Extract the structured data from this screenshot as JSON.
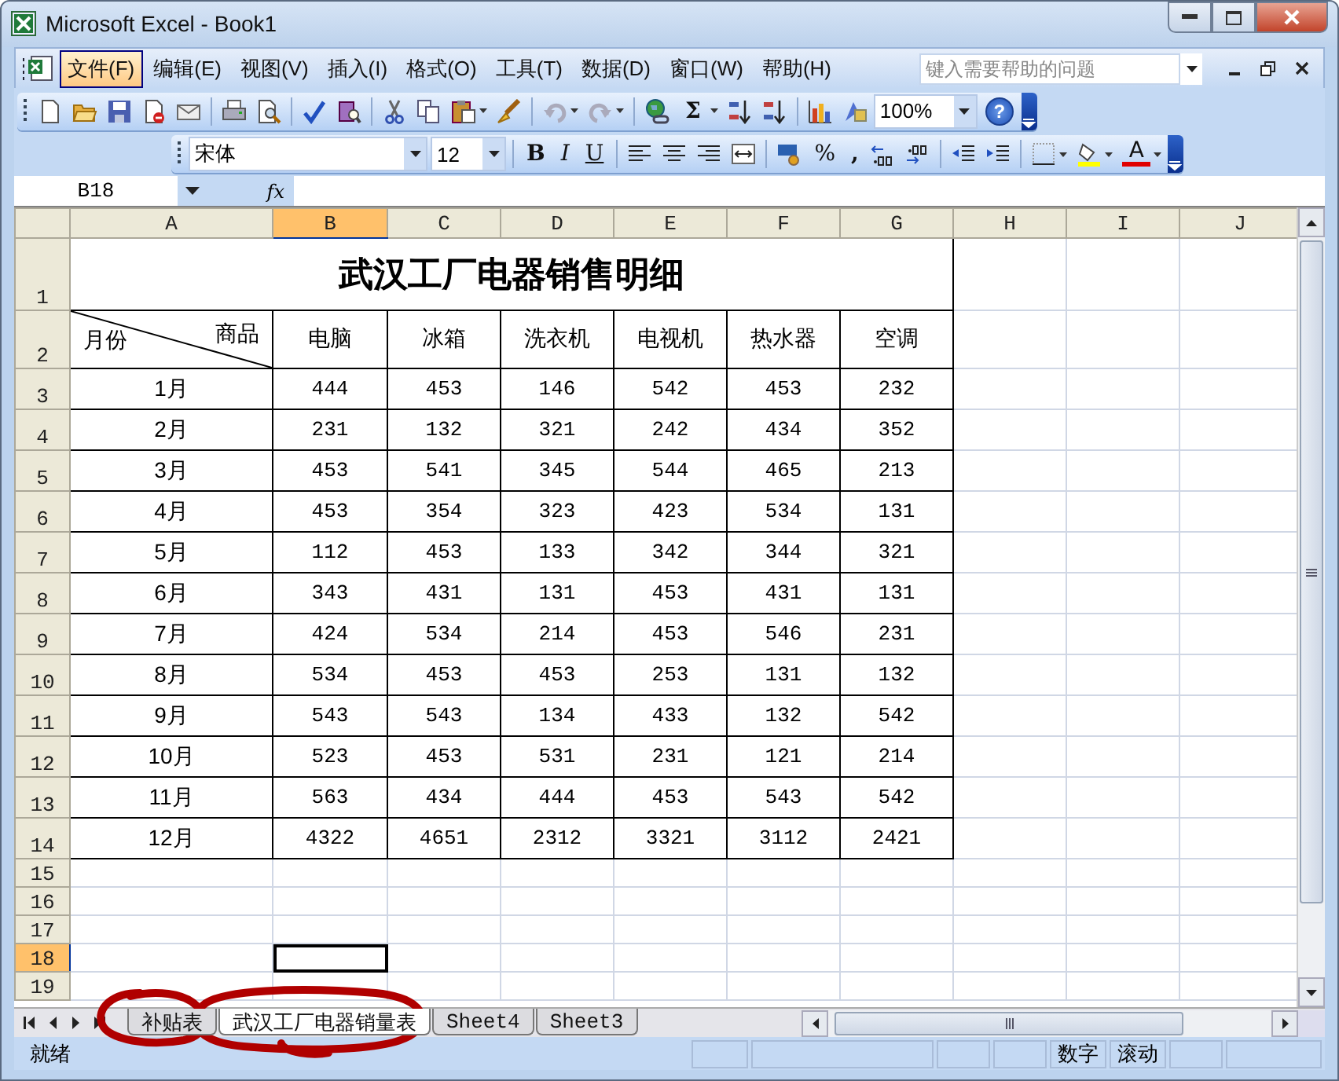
{
  "window": {
    "title": "Microsoft Excel - Book1"
  },
  "menu": [
    {
      "label": "文件(F)",
      "selected": true
    },
    {
      "label": "编辑(E)",
      "selected": false
    },
    {
      "label": "视图(V)",
      "selected": false
    },
    {
      "label": "插入(I)",
      "selected": false
    },
    {
      "label": "格式(O)",
      "selected": false
    },
    {
      "label": "工具(T)",
      "selected": false
    },
    {
      "label": "数据(D)",
      "selected": false
    },
    {
      "label": "窗口(W)",
      "selected": false
    },
    {
      "label": "帮助(H)",
      "selected": false
    }
  ],
  "help_box": {
    "placeholder": "键入需要帮助的问题"
  },
  "standard_toolbar": {
    "autosum": "Σ",
    "zoom": "100%",
    "help": "?"
  },
  "formatting_toolbar": {
    "font": "宋体",
    "size": "12",
    "bold": "B",
    "italic": "I",
    "underline": "U",
    "percent": "%",
    "comma": ",",
    "font_color": "A"
  },
  "formula_bar": {
    "name_box": "B18",
    "fx": "fx"
  },
  "column_headers": [
    {
      "label": "A",
      "selected": false
    },
    {
      "label": "B",
      "selected": true
    },
    {
      "label": "C",
      "selected": false
    },
    {
      "label": "D",
      "selected": false
    },
    {
      "label": "E",
      "selected": false
    },
    {
      "label": "F",
      "selected": false
    },
    {
      "label": "G",
      "selected": false
    },
    {
      "label": "H",
      "selected": false
    },
    {
      "label": "I",
      "selected": false
    },
    {
      "label": "J",
      "selected": false
    }
  ],
  "row_headers": [
    {
      "label": "1",
      "selected": false
    },
    {
      "label": "2",
      "selected": false
    },
    {
      "label": "3",
      "selected": false
    },
    {
      "label": "4",
      "selected": false
    },
    {
      "label": "5",
      "selected": false
    },
    {
      "label": "6",
      "selected": false
    },
    {
      "label": "7",
      "selected": false
    },
    {
      "label": "8",
      "selected": false
    },
    {
      "label": "9",
      "selected": false
    },
    {
      "label": "10",
      "selected": false
    },
    {
      "label": "11",
      "selected": false
    },
    {
      "label": "12",
      "selected": false
    },
    {
      "label": "13",
      "selected": false
    },
    {
      "label": "14",
      "selected": false
    },
    {
      "label": "15",
      "selected": false
    },
    {
      "label": "16",
      "selected": false
    },
    {
      "label": "17",
      "selected": false
    },
    {
      "label": "18",
      "selected": true
    },
    {
      "label": "19",
      "selected": false
    }
  ],
  "sheet": {
    "title": "武汉工厂电器销售明细",
    "corner_row_label": "月份",
    "corner_column_label": "商品",
    "products": [
      "电脑",
      "冰箱",
      "洗衣机",
      "电视机",
      "热水器",
      "空调"
    ],
    "rows": [
      {
        "month": "1月",
        "values": [
          "444",
          "453",
          "146",
          "542",
          "453",
          "232"
        ]
      },
      {
        "month": "2月",
        "values": [
          "231",
          "132",
          "321",
          "242",
          "434",
          "352"
        ]
      },
      {
        "month": "3月",
        "values": [
          "453",
          "541",
          "345",
          "544",
          "465",
          "213"
        ]
      },
      {
        "month": "4月",
        "values": [
          "453",
          "354",
          "323",
          "423",
          "534",
          "131"
        ]
      },
      {
        "month": "5月",
        "values": [
          "112",
          "453",
          "133",
          "342",
          "344",
          "321"
        ]
      },
      {
        "month": "6月",
        "values": [
          "343",
          "431",
          "131",
          "453",
          "431",
          "131"
        ]
      },
      {
        "month": "7月",
        "values": [
          "424",
          "534",
          "214",
          "453",
          "546",
          "231"
        ]
      },
      {
        "month": "8月",
        "values": [
          "534",
          "453",
          "453",
          "253",
          "131",
          "132"
        ]
      },
      {
        "month": "9月",
        "values": [
          "543",
          "543",
          "134",
          "433",
          "132",
          "542"
        ]
      },
      {
        "month": "10月",
        "values": [
          "523",
          "453",
          "531",
          "231",
          "121",
          "214"
        ]
      },
      {
        "month": "11月",
        "values": [
          "563",
          "434",
          "444",
          "453",
          "543",
          "542"
        ]
      },
      {
        "month": "12月",
        "values": [
          "4322",
          "4651",
          "2312",
          "3321",
          "3112",
          "2421"
        ]
      }
    ]
  },
  "sheet_tabs": [
    {
      "label": "补贴表",
      "selected": false
    },
    {
      "label": "武汉工厂电器销量表",
      "selected": true
    },
    {
      "label": "Sheet4",
      "selected": false
    },
    {
      "label": "Sheet3",
      "selected": false
    }
  ],
  "status_bar": {
    "status": "就绪",
    "indicators": [
      "数字",
      "滚动"
    ]
  }
}
